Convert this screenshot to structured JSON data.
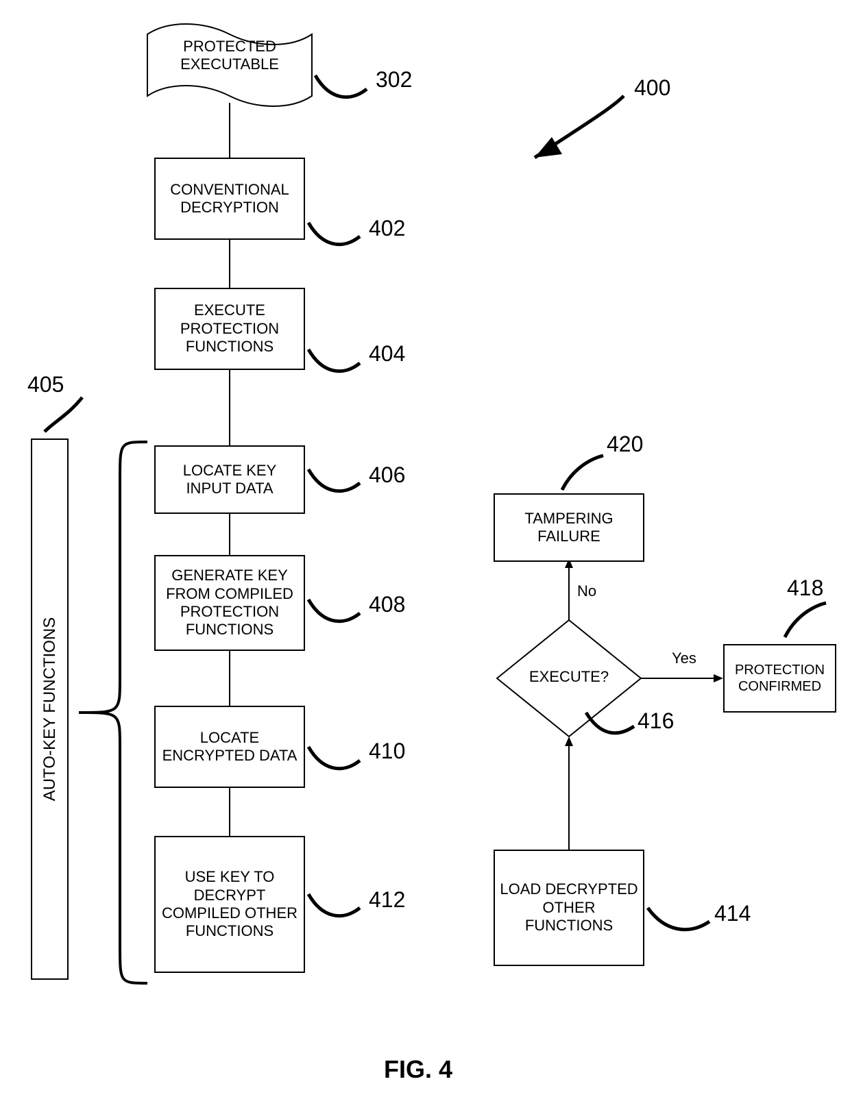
{
  "figure_label": "FIG. 4",
  "ref_400": "400",
  "ref_302": "302",
  "ref_402": "402",
  "ref_404": "404",
  "ref_405": "405",
  "ref_406": "406",
  "ref_408": "408",
  "ref_410": "410",
  "ref_412": "412",
  "ref_414": "414",
  "ref_416": "416",
  "ref_418": "418",
  "ref_420": "420",
  "box302": "PROTECTED EXECUTABLE",
  "box402": "CONVENTIONAL DECRYPTION",
  "box404": "EXECUTE PROTECTION FUNCTIONS",
  "box406": "LOCATE KEY INPUT DATA",
  "box408": "GENERATE KEY FROM COMPILED PROTECTION FUNCTIONS",
  "box410": "LOCATE ENCRYPTED DATA",
  "box412": "USE KEY TO DECRYPT COMPILED OTHER FUNCTIONS",
  "box414": "LOAD DECRYPTED OTHER FUNCTIONS",
  "box416": "EXECUTE?",
  "box418": "PROTECTION CONFIRMED",
  "box420": "TAMPERING FAILURE",
  "side405": "AUTO-KEY FUNCTIONS",
  "yes": "Yes",
  "no": "No"
}
